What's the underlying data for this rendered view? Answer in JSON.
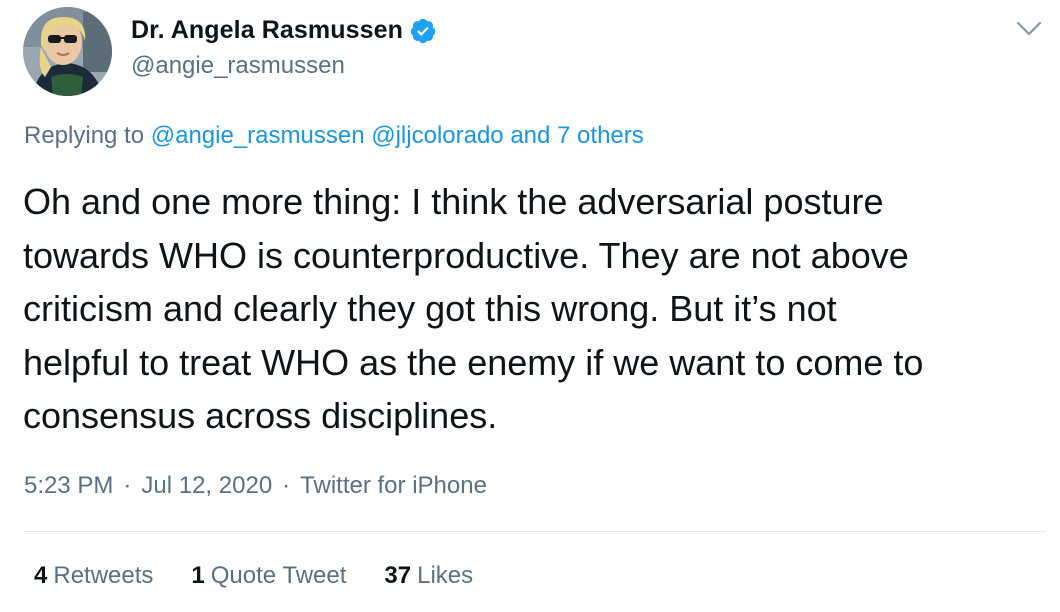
{
  "author": {
    "display_name": "Dr. Angela Rasmussen",
    "handle": "@angie_rasmussen",
    "verified": true
  },
  "reply": {
    "prefix": "Replying to",
    "mention_1": "@angie_rasmussen",
    "mention_2": "@jljcolorado",
    "others": "and 7 others"
  },
  "tweet": {
    "text": "Oh and one more thing: I think the adversarial posture\ntowards WHO is counterproductive. They are not above\ncriticism and clearly they got this wrong. But it’s not\nhelpful to treat WHO as the enemy if we want to come to\nconsensus across disciplines."
  },
  "meta": {
    "time": "5:23 PM",
    "separator": "·",
    "date": "Jul 12, 2020",
    "source": "Twitter for iPhone"
  },
  "stats": {
    "retweets_count": "4",
    "retweets_label": "Retweets",
    "quotes_count": "1",
    "quotes_label": "Quote Tweet",
    "likes_count": "37",
    "likes_label": "Likes"
  },
  "icons": {
    "verified_badge": "verified-badge-icon",
    "more_menu": "chevron-down-icon"
  },
  "colors": {
    "text": "#0f1419",
    "secondary": "#5b7083",
    "link": "#1b95e0",
    "verified": "#1da1f2",
    "divider": "#e1e8ed"
  }
}
